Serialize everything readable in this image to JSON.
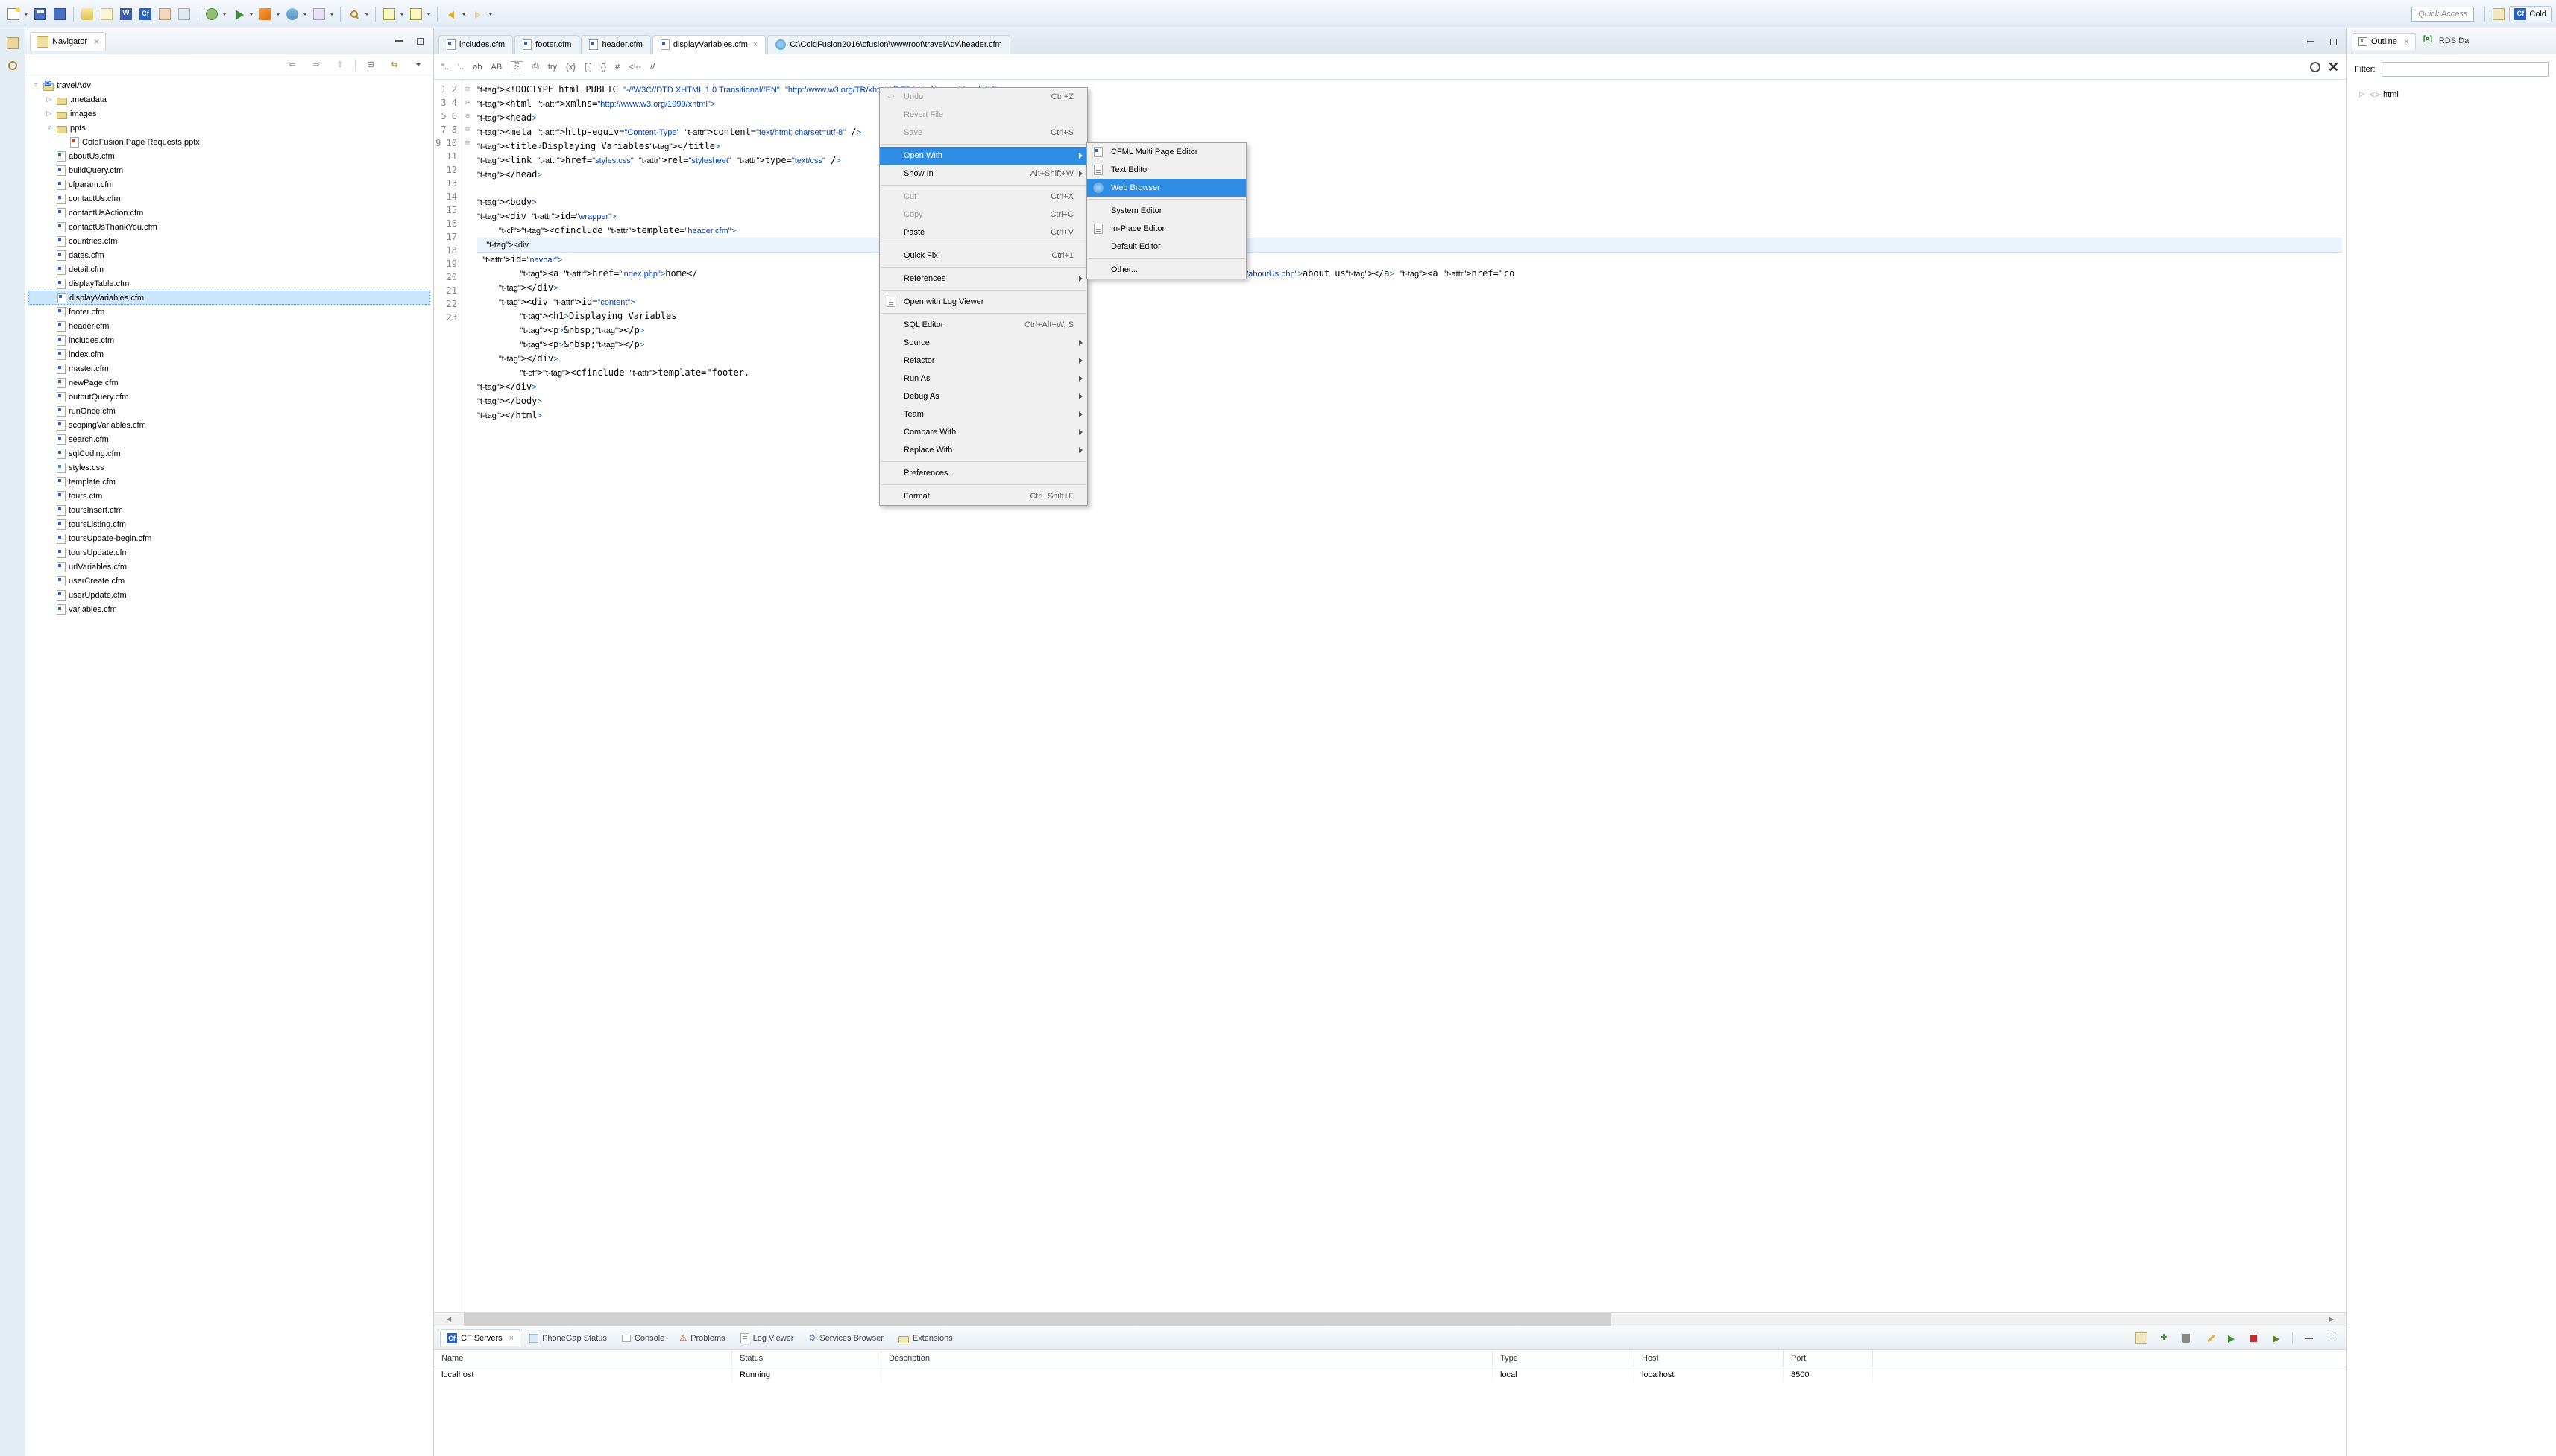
{
  "quick_access_placeholder": "Quick Access",
  "perspective_label": "Cold",
  "navigator": {
    "title": "Navigator",
    "project": "travelAdv",
    "folders": [
      ".metadata",
      "images",
      "ppts"
    ],
    "ppt_file": "ColdFusion Page Requests.pptx",
    "files": [
      "aboutUs.cfm",
      "buildQuery.cfm",
      "cfparam.cfm",
      "contactUs.cfm",
      "contactUsAction.cfm",
      "contactUsThankYou.cfm",
      "countries.cfm",
      "dates.cfm",
      "detail.cfm",
      "displayTable.cfm",
      "displayVariables.cfm",
      "footer.cfm",
      "header.cfm",
      "includes.cfm",
      "index.cfm",
      "master.cfm",
      "newPage.cfm",
      "outputQuery.cfm",
      "runOnce.cfm",
      "scopingVariables.cfm",
      "search.cfm",
      "sqlCoding.cfm",
      "styles.css",
      "template.cfm",
      "tours.cfm",
      "toursInsert.cfm",
      "toursListing.cfm",
      "toursUpdate-begin.cfm",
      "toursUpdate.cfm",
      "urlVariables.cfm",
      "userCreate.cfm",
      "userUpdate.cfm",
      "variables.cfm"
    ],
    "selected": "displayVariables.cfm"
  },
  "editor_tabs": [
    {
      "label": "includes.cfm",
      "icon": "cf",
      "active": false
    },
    {
      "label": "footer.cfm",
      "icon": "cf",
      "active": false
    },
    {
      "label": "header.cfm",
      "icon": "cf",
      "active": false
    },
    {
      "label": "displayVariables.cfm",
      "icon": "cf",
      "active": true
    },
    {
      "label": "C:\\ColdFusion2016\\cfusion\\wwwroot\\travelAdv\\header.cfm",
      "icon": "globe",
      "active": false
    }
  ],
  "sub_toolbar": [
    "\"..",
    "'..",
    "ab",
    "AB",
    "try",
    "#",
    "//"
  ],
  "code_lines": [
    "<!DOCTYPE html PUBLIC \"-//W3C//DTD XHTML 1.0 Transitional//EN\" \"http://www.w3.org/TR/xhtml1/DTD/xhtml1-transitional.dtd\">",
    "<html xmlns=\"http://www.w3.org/1999/xhtml\">",
    "<head>",
    "<meta http-equiv=\"Content-Type\" content=\"text/html; charset=utf-8\" />",
    "<title>Displaying Variables</title>",
    "<link href=\"styles.css\" rel=\"stylesheet\" type=\"text/css\" />",
    "</head>",
    "",
    "<body>",
    "<div id=\"wrapper\">",
    "    <cfinclude template=\"header.cfm\">",
    "    <div id=\"navbar\">",
    "        <a href=\"index.php\">home</                                         a href=\"countries.php\">countries</a> <a href=\"aboutUs.php\">about us</a> <a href=\"co",
    "    </div>",
    "    <div id=\"content\">",
    "        <h1>Displaying Variables",
    "        <p>&nbsp;</p>",
    "        <p>&nbsp;</p>",
    "    </div>",
    "        <cfinclude template=\"footer.",
    "</div>",
    "</body>",
    "</html>"
  ],
  "context_main": [
    {
      "label": "Undo",
      "short": "Ctrl+Z",
      "disabled": true,
      "icon": "undo"
    },
    {
      "label": "Revert File",
      "disabled": true
    },
    {
      "label": "Save",
      "short": "Ctrl+S",
      "disabled": true
    },
    {
      "sep": true
    },
    {
      "label": "Open With",
      "sub": true,
      "hl": true
    },
    {
      "label": "Show In",
      "short": "Alt+Shift+W",
      "sub": true
    },
    {
      "sep": true
    },
    {
      "label": "Cut",
      "short": "Ctrl+X",
      "disabled": true
    },
    {
      "label": "Copy",
      "short": "Ctrl+C",
      "disabled": true
    },
    {
      "label": "Paste",
      "short": "Ctrl+V"
    },
    {
      "sep": true
    },
    {
      "label": "Quick Fix",
      "short": "Ctrl+1"
    },
    {
      "sep": true
    },
    {
      "label": "References",
      "sub": true
    },
    {
      "sep": true
    },
    {
      "label": "Open with Log Viewer",
      "icon": "doc"
    },
    {
      "sep": true
    },
    {
      "label": "SQL Editor",
      "short": "Ctrl+Alt+W, S"
    },
    {
      "label": "Source",
      "sub": true
    },
    {
      "label": "Refactor",
      "sub": true
    },
    {
      "label": "Run As",
      "sub": true
    },
    {
      "label": "Debug As",
      "sub": true
    },
    {
      "label": "Team",
      "sub": true
    },
    {
      "label": "Compare With",
      "sub": true
    },
    {
      "label": "Replace With",
      "sub": true
    },
    {
      "sep": true
    },
    {
      "label": "Preferences..."
    },
    {
      "sep": true
    },
    {
      "label": "Format",
      "short": "Ctrl+Shift+F"
    }
  ],
  "context_sub": [
    {
      "label": "CFML Multi Page Editor",
      "icon": "cf"
    },
    {
      "label": "Text Editor",
      "icon": "doc"
    },
    {
      "label": "Web Browser",
      "icon": "globe",
      "hl": true
    },
    {
      "sep": true
    },
    {
      "label": "System Editor"
    },
    {
      "label": "In-Place Editor",
      "icon": "doc"
    },
    {
      "label": "Default Editor"
    },
    {
      "sep": true
    },
    {
      "label": "Other..."
    }
  ],
  "outline": {
    "tab1": "Outline",
    "tab2": "RDS Da",
    "filter_label": "Filter:",
    "root": "html"
  },
  "bottom": {
    "tabs": [
      "CF Servers",
      "PhoneGap Status",
      "Console",
      "Problems",
      "Log Viewer",
      "Services Browser",
      "Extensions"
    ],
    "active_tab": "CF Servers",
    "cols": [
      "Name",
      "Status",
      "Description",
      "Type",
      "Host",
      "Port"
    ],
    "row": {
      "name": "localhost",
      "status": "Running",
      "desc": "",
      "type": "local",
      "host": "localhost",
      "port": "8500"
    }
  }
}
